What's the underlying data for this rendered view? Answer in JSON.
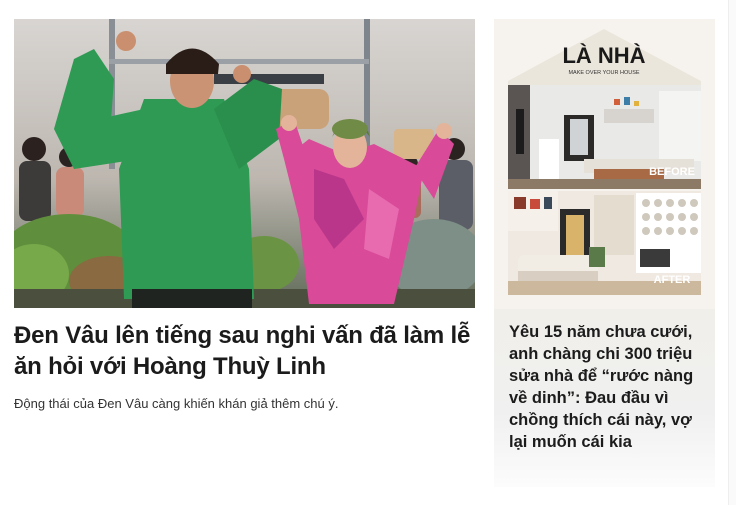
{
  "main_story": {
    "headline": "Đen Vâu lên tiếng sau nghi vấn đã làm lễ ăn hỏi với Hoàng Thuỳ Linh",
    "sapo": "Động thái của Đen Vâu càng khiến khán giả thêm chú ý."
  },
  "side_story": {
    "brand": "LÀ NHÀ",
    "brand_tagline": "MAKE OVER YOUR HOUSE",
    "before_label": "BEFORE",
    "after_label": "AFTER",
    "title": "Yêu 15 năm chưa cưới, anh chàng chi 300 triệu sửa nhà để “rước nàng về dinh”: Đau đầu vì chồng thích cái này, vợ lại muốn cái kia"
  },
  "colors": {
    "hoodie_green": "#2f9a53",
    "dress_pink": "#d94a98",
    "card_bg": "#f6f3ee"
  }
}
